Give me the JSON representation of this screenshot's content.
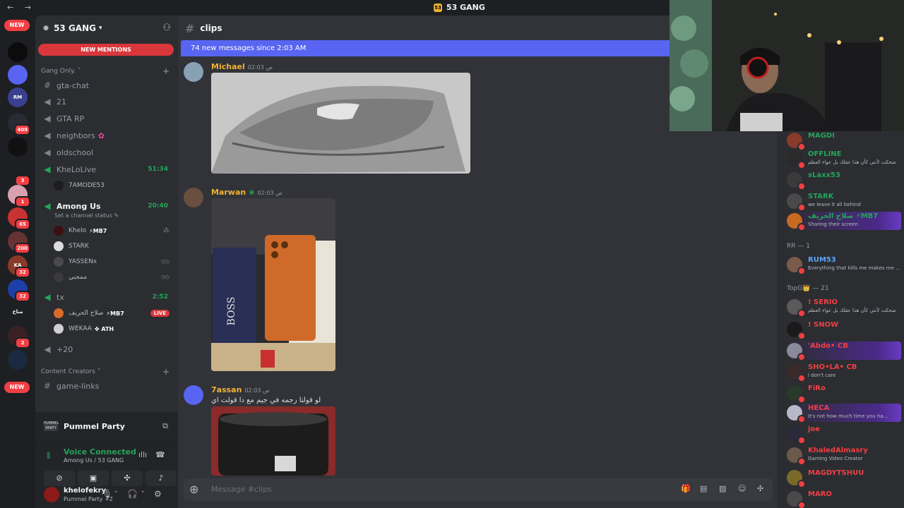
{
  "titlebar": {
    "title": "53 GANG",
    "nav": "← →",
    "guild_icon": "53"
  },
  "rail": {
    "new_top": "NEW",
    "new_bottom": "NEW",
    "servers": [
      {
        "label": "",
        "badge": "",
        "color": "#0c0c0c"
      },
      {
        "label": "",
        "badge": "",
        "color": "#5865f2"
      },
      {
        "label": "RM",
        "badge": "",
        "color": "#3a3f8f"
      },
      {
        "label": "",
        "badge": "409",
        "color": "#2a2a35"
      },
      {
        "label": "",
        "badge": "",
        "color": "#111"
      },
      {
        "label": "",
        "badge": "3",
        "color": "#1e1f22"
      },
      {
        "label": "",
        "badge": "1",
        "color": "#d9a0b0"
      },
      {
        "label": "",
        "badge": "65",
        "color": "#c83232"
      },
      {
        "label": "",
        "badge": "200",
        "color": "#663333"
      },
      {
        "label": "KA",
        "badge": "32",
        "color": "#8a3a2a"
      },
      {
        "label": "",
        "badge": "32",
        "color": "#1d3fa8"
      },
      {
        "label": "مناخ",
        "badge": "",
        "color": "#1e1f22"
      },
      {
        "label": "",
        "badge": "2",
        "color": "#3a2222"
      },
      {
        "label": "",
        "badge": "",
        "color": "#1a2a40"
      }
    ]
  },
  "guild": {
    "name": "53 GANG",
    "mentions_label": "NEW MENTIONS"
  },
  "categories": {
    "gang": "Gang Only.",
    "content": "Content Creators"
  },
  "channels": {
    "gta_chat": "gta-chat",
    "c21": "21",
    "gta_rp": "GTA RP",
    "neighbors": "neighbors",
    "oldschool": "oldschool",
    "khelolive": "KheLoLive",
    "khelolive_time": "51:34",
    "khelolive_user": "7AMODE53",
    "among_us": "Among Us",
    "among_us_time": "20:40",
    "among_us_status": "Set a channel status",
    "tx": "tx",
    "tx_time": "2:52",
    "more": "+20",
    "game_links": "game-links"
  },
  "voice_users_among": [
    {
      "name": "Khelo",
      "tag": "⚡MB7",
      "icon": "⁂"
    },
    {
      "name": "STARK",
      "tag": "",
      "icon": ""
    },
    {
      "name": "YASSENx",
      "tag": "",
      "icon": "⦸⦸"
    },
    {
      "name": "ممجبي",
      "tag": "",
      "icon": "⦸⦸"
    }
  ],
  "voice_users_tx": [
    {
      "name": "صلاح الحريف",
      "tag": "⚡MB7",
      "live": "LIVE"
    },
    {
      "name": "WEKAA",
      "tag": "✤ ATH",
      "live": ""
    }
  ],
  "activity": {
    "name": "Pummel Party",
    "logo": "PUMMEL PARTY"
  },
  "voice": {
    "title": "Voice Connected",
    "sub": "Among Us / 53 GANG"
  },
  "user": {
    "name": "khelofekry",
    "status": "Pummel Party +2"
  },
  "chat": {
    "channel": "clips",
    "new_messages": "74 new messages since 2:03 AM",
    "placeholder": "Message #clips",
    "messages": [
      {
        "author": "Michael",
        "color": "#f0b232",
        "time": "02:03 ص",
        "text": ""
      },
      {
        "author": "Marwan",
        "color": "#f0b232",
        "time": "02:03 ص",
        "text": ""
      },
      {
        "author": "7assan",
        "color": "#f0b232",
        "time": "02:03 ص",
        "text": "لو قولتا رجمه في جيم مع دا قولت اي"
      }
    ]
  },
  "members": {
    "cat_rr": "RR — 1",
    "cat_topg": "TopG👑 — 21",
    "list": [
      {
        "name": "MAGDI",
        "status": "",
        "color": "#23a55a"
      },
      {
        "name": "OFFLINE",
        "status": "ضحكت لأنتي كأن هذا عقلك بل عواء العظم",
        "color": "#23a55a"
      },
      {
        "name": "sLaxx53",
        "status": "",
        "color": "#23a55a"
      },
      {
        "name": "STARK",
        "status": "we leave it all behind",
        "color": "#23a55a"
      },
      {
        "name": "صلاح الحريف ⚡MB7",
        "status": "Sharing their screen",
        "color": "#23a55a"
      },
      {
        "name": "RUM53",
        "status": "Everything that kills me makes me ...",
        "color": "#5ba4ff"
      },
      {
        "name": "! SERIO",
        "status": "ضحكت لأنتي كأن هذا عقلك بل عواء العظم",
        "color": "#f23f43"
      },
      {
        "name": "! SNOW",
        "status": "",
        "color": "#f23f43"
      },
      {
        "name": "'Abdo• CB",
        "status": "",
        "color": "#f23f43"
      },
      {
        "name": "SHO•LA• CB",
        "status": "i don't care",
        "color": "#f23f43"
      },
      {
        "name": "FiRo",
        "status": "",
        "color": "#f23f43"
      },
      {
        "name": "HECA",
        "status": "It's not how much time you ha...",
        "color": "#f23f43"
      },
      {
        "name": "joe",
        "status": "",
        "color": "#f23f43"
      },
      {
        "name": "KhaledAlmasry",
        "status": "Gaming Video Creator",
        "color": "#f23f43"
      },
      {
        "name": "MAGDYTSHUU",
        "status": "",
        "color": "#f23f43"
      },
      {
        "name": "MARO",
        "status": "",
        "color": "#f23f43"
      }
    ]
  }
}
